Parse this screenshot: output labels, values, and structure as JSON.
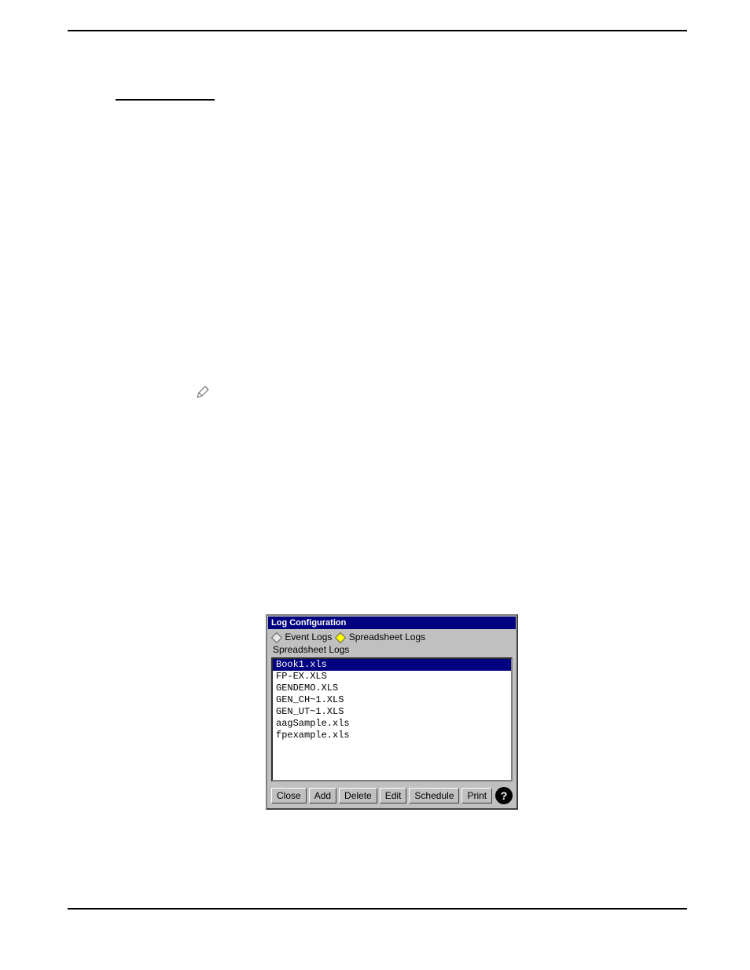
{
  "dialog": {
    "title": "Log Configuration",
    "tabs": {
      "event_logs": "Event Logs",
      "spreadsheet_logs": "Spreadsheet Logs"
    },
    "subtitle": "Spreadsheet Logs",
    "list_items": [
      "Book1.xls",
      "FP-EX.XLS",
      "GENDEMO.XLS",
      "GEN_CH~1.XLS",
      "GEN_UT~1.XLS",
      "aagSample.xls",
      "fpexample.xls"
    ],
    "selected_index": 0,
    "buttons": {
      "close": "Close",
      "add": "Add",
      "delete": "Delete",
      "edit": "Edit",
      "schedule": "Schedule",
      "print": "Print"
    },
    "help_label": "?"
  }
}
